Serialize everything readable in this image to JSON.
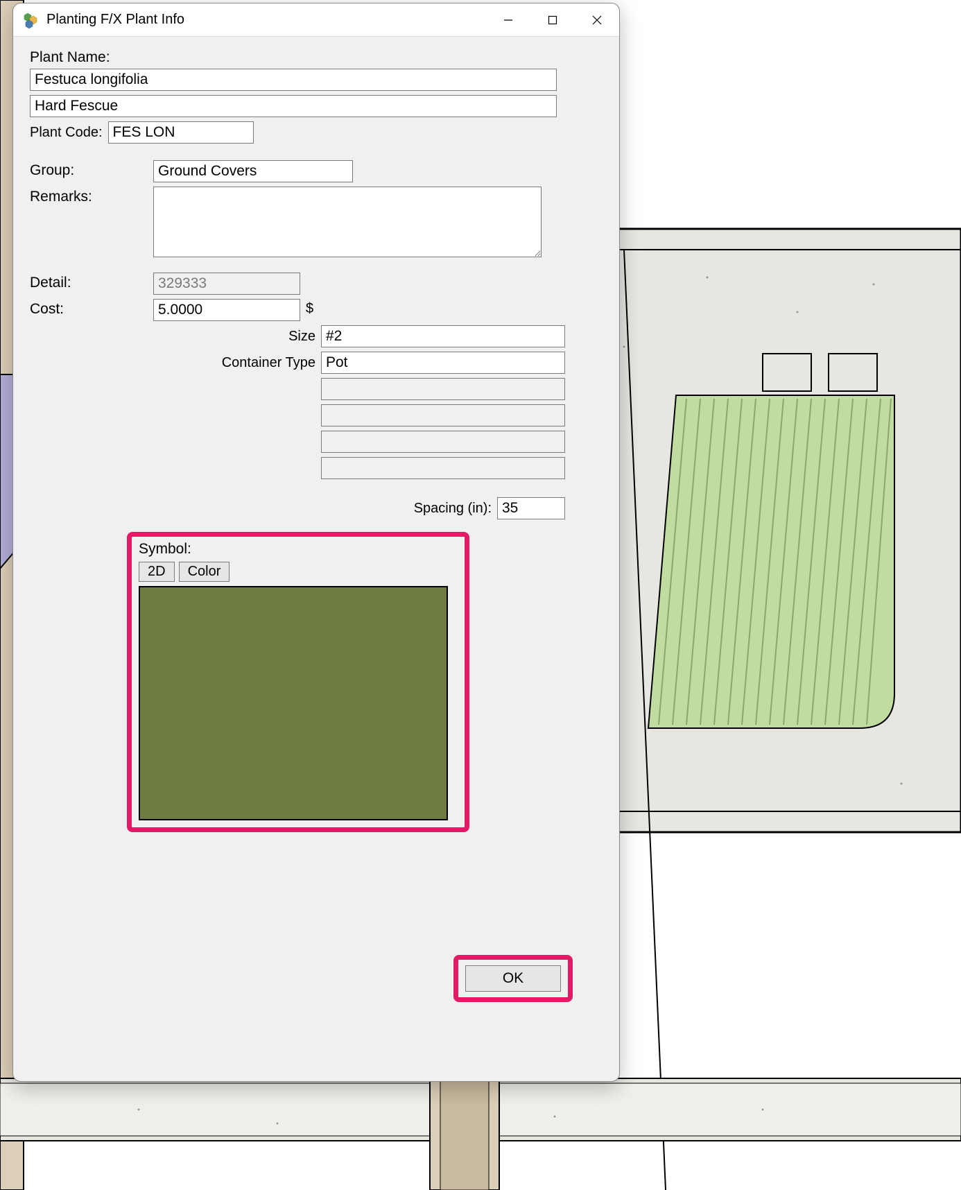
{
  "window": {
    "title": "Planting F/X Plant Info"
  },
  "labels": {
    "plant_name": "Plant Name:",
    "plant_code": "Plant Code:",
    "group": "Group:",
    "remarks": "Remarks:",
    "detail": "Detail:",
    "cost": "Cost:",
    "size": "Size",
    "container_type": "Container Type",
    "spacing": "Spacing (in):",
    "symbol": "Symbol:",
    "currency": "$"
  },
  "values": {
    "botanical_name": "Festuca longifolia",
    "common_name": "Hard Fescue",
    "plant_code": "FES LON",
    "group": "Ground Covers",
    "remarks": "",
    "detail": "329333",
    "cost": "5.0000",
    "size": "#2",
    "container_type": "Pot",
    "extra1": "",
    "extra2": "",
    "extra3": "",
    "extra4": "",
    "spacing": "35"
  },
  "symbol": {
    "btn_2d": "2D",
    "btn_color": "Color",
    "swatch_color": "#6e7c44"
  },
  "buttons": {
    "ok": "OK"
  },
  "highlight_color": "#e31b67"
}
